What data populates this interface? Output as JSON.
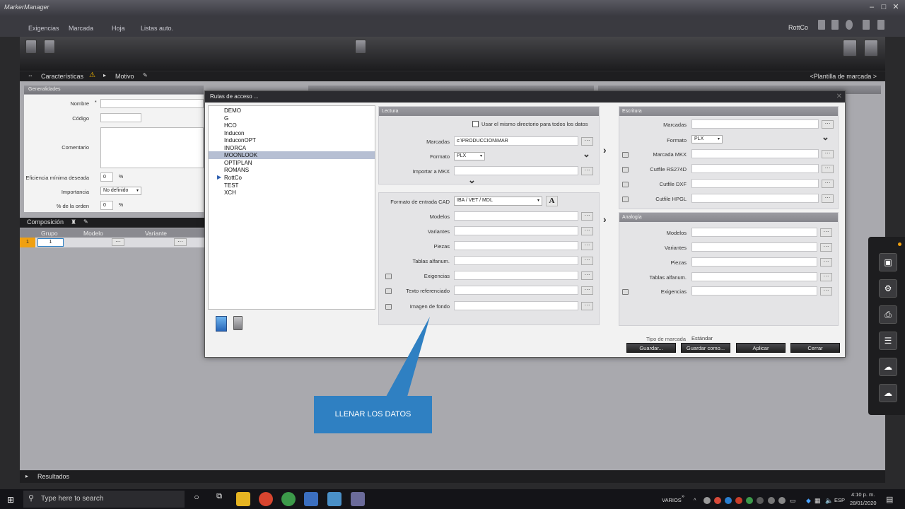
{
  "app": {
    "title": "MarkerManager"
  },
  "menu": {
    "items": [
      "Exigencias",
      "Marcada",
      "Hoja",
      "Listas auto."
    ],
    "user": "RottCo"
  },
  "tabs": {
    "characteristics": "Características",
    "motivo": "Motivo",
    "template": "<Plantilla de marcada >"
  },
  "generalities": {
    "header": "Generalidades",
    "labels": {
      "nombre": "Nombre",
      "codigo": "Código",
      "comentario": "Comentario",
      "eficiencia": "Eficiencia mínima deseada",
      "importancia": "Importancia",
      "orden": "% de la orden"
    },
    "values": {
      "eficiencia": "0",
      "importancia": "No definido",
      "orden": "0"
    },
    "percent": "%"
  },
  "composition": {
    "title": "Composición",
    "columns": [
      "Grupo",
      "Modelo",
      "Variante"
    ],
    "row": {
      "index": "1",
      "grupo": "1"
    }
  },
  "results": {
    "title": "Resultados"
  },
  "dialog": {
    "title": "Rutas de acceso ...",
    "list": [
      {
        "label": "DEMO"
      },
      {
        "label": "G"
      },
      {
        "label": "HCO"
      },
      {
        "label": "Inducon"
      },
      {
        "label": "InduconOPT"
      },
      {
        "label": "INORCA"
      },
      {
        "label": "MOONLOOK",
        "selected": true
      },
      {
        "label": "OPTIPLAN"
      },
      {
        "label": "ROMANS"
      },
      {
        "label": "RottCo",
        "active": true
      },
      {
        "label": "TEST"
      },
      {
        "label": "XCH"
      }
    ],
    "lectura": {
      "header": "Lectura",
      "same_dir": "Usar el mismo directorio para todos los datos",
      "marcadas_label": "Marcadas",
      "marcadas_value": "c:\\PRODUCCION\\MAR",
      "formato_label": "Formato",
      "formato_value": "PLX",
      "importar_label": "Importar a MKX",
      "cad_label": "Formato de entrada CAD",
      "cad_value": "IBA / VET / MDL",
      "fields": [
        "Modelos",
        "Variantes",
        "Piezas",
        "Tablas alfanum.",
        "Exigencias",
        "Texto referenciado",
        "Imagen de fondo"
      ]
    },
    "escritura": {
      "header": "Escritura",
      "marcadas_label": "Marcadas",
      "formato_label": "Formato",
      "formato_value": "PLX",
      "fields": [
        "Marcada MKX",
        "Cutfile RS274D",
        "Cutfile DXF",
        "Cutfile HPGL"
      ]
    },
    "analogia": {
      "header": "Analogía",
      "fields": [
        "Modelos",
        "Variantes",
        "Piezas",
        "Tablas alfanum.",
        "Exigencias"
      ]
    },
    "tipo_label": "Tipo de marcada",
    "tipo_value": "Estándar",
    "buttons": {
      "guardar": "Guardar...",
      "guardar_como": "Guardar como...",
      "aplicar": "Aplicar",
      "cerrar": "Cerrar"
    },
    "dots": "···"
  },
  "callout": {
    "text": "LLENAR LOS DATOS"
  },
  "taskbar": {
    "search_placeholder": "Type here to search",
    "varios": "VARIOS",
    "lang": "ESP",
    "time": "4:10 p. m.",
    "date": "28/01/2020"
  },
  "colors": {
    "accent": "#2f80c2",
    "selection": "#b6bfd3",
    "dark": "#1e1e20"
  }
}
